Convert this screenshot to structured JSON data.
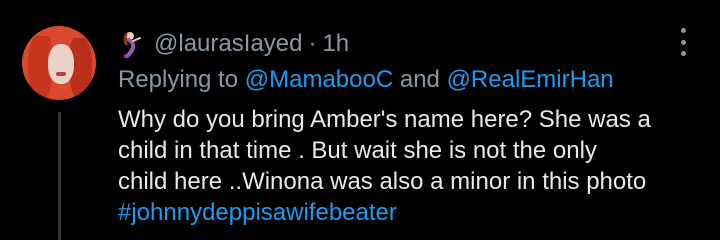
{
  "tweet": {
    "handle": "@laurasIayed",
    "separator": "·",
    "time": "1h",
    "reply_prefix": "Replying to",
    "mention_1": "@MamabooC",
    "reply_and": "and",
    "mention_2": "@RealEmirHan",
    "body_lines": [
      "Why do you bring Amber's name here? She was a",
      "child in that time . But wait she is not the only",
      "child here ..Winona was also a minor in this photo"
    ],
    "hashtag": "#johnnydeppisawifebeater"
  },
  "icons": {
    "avatar": "profile-photo",
    "name_emoji": "mermaid-emoji",
    "more": "more-options-icon"
  },
  "colors": {
    "background": "#000000",
    "text": "#e7e9ea",
    "muted": "#8b98a5",
    "link": "#1d9bf0"
  }
}
